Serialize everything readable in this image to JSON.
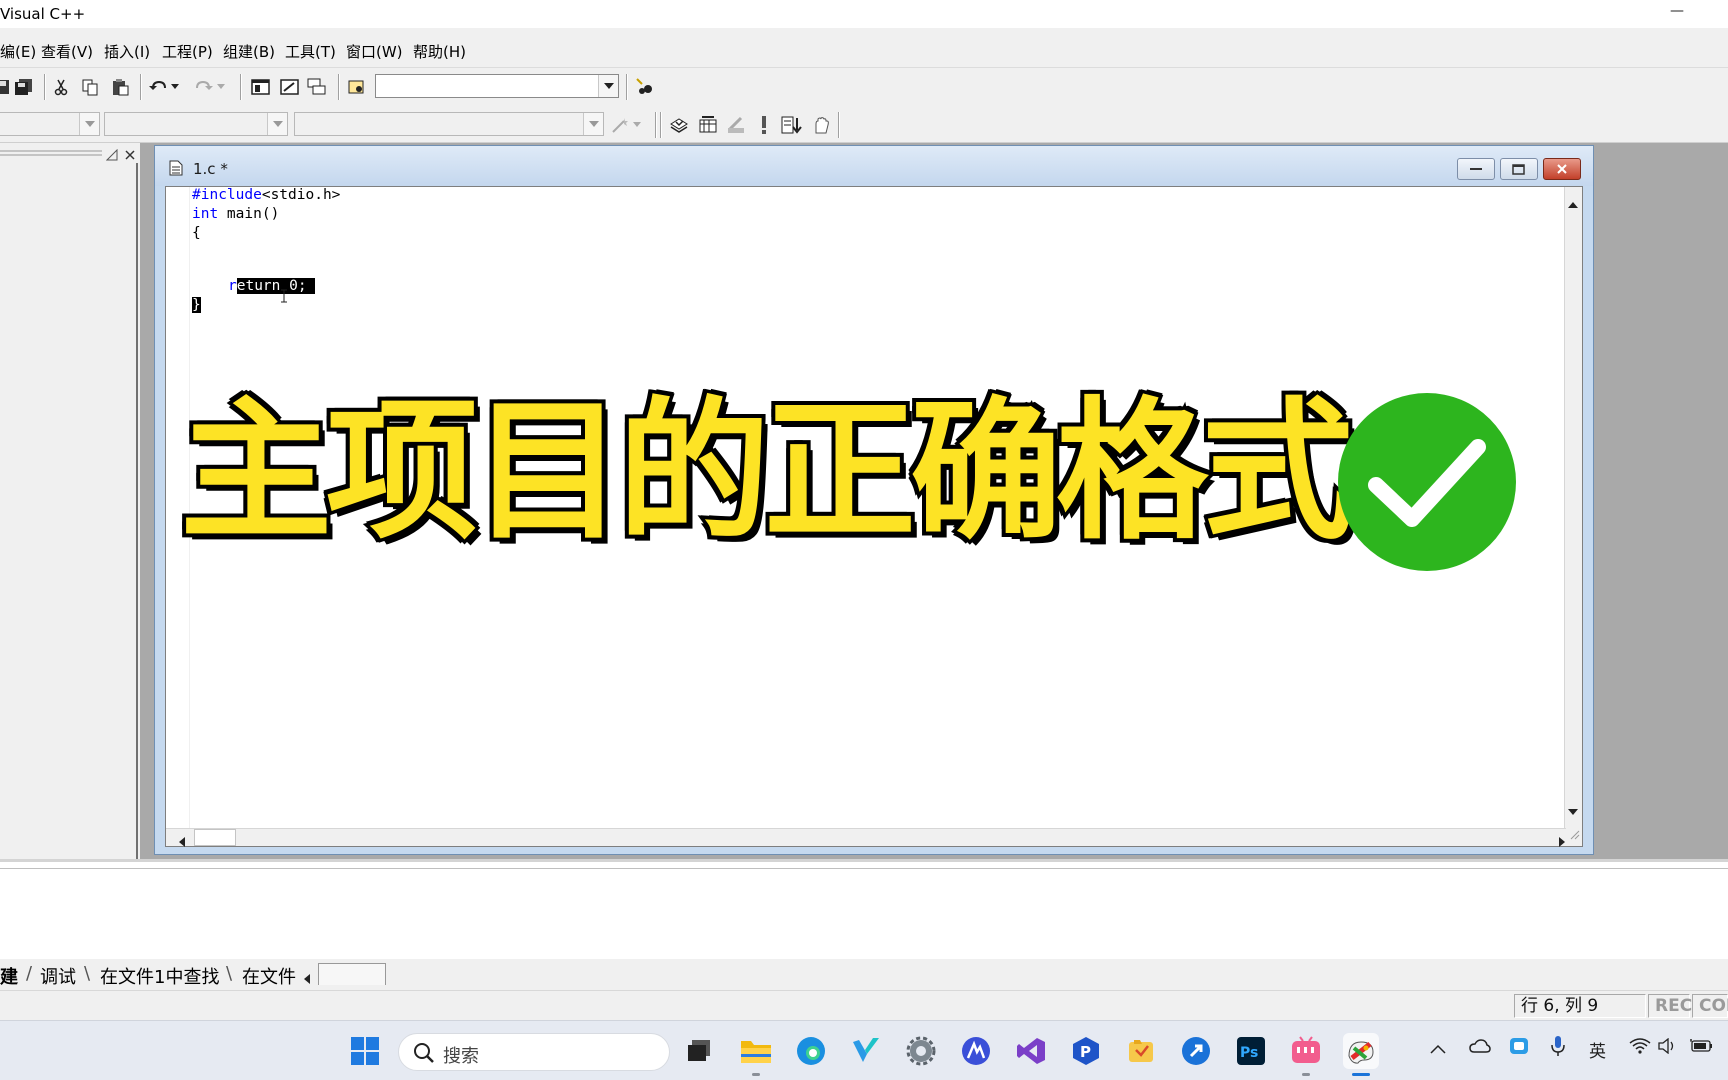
{
  "app": {
    "title": "Visual C++",
    "minimize_glyph": "—"
  },
  "menu": [
    "编(E)",
    "查看(V)",
    "插入(I)",
    "工程(P)",
    "组建(B)",
    "工具(T)",
    "窗口(W)",
    "帮助(H)"
  ],
  "document": {
    "title": "1.c *"
  },
  "code": {
    "line1_kw": "#include",
    "line1_rest": "<stdio.h>",
    "line2_kw": "int",
    "line2_rest": " main()",
    "line3": "{",
    "line5_prefix": "r",
    "line5_selected": "eturn 0; ",
    "line6": "}"
  },
  "overlay": {
    "headline": "主项目的正确格式"
  },
  "output_tabs": [
    "建",
    "调试",
    "在文件1中查找",
    "在文件"
  ],
  "status": {
    "position": "行 6, 列 9",
    "rec": "REC",
    "col": "COL"
  },
  "taskbar": {
    "search_placeholder": "搜索",
    "input_method": "英"
  },
  "colors": {
    "headline_fill": "#fde325",
    "headline_stroke": "#000000",
    "check_green": "#2db51e",
    "keyword_blue": "#0000ff"
  },
  "icons": {
    "taskbar": [
      "windows-start-icon",
      "search-icon",
      "task-view-icon",
      "file-explorer-icon",
      "edge-icon",
      "app-v-icon",
      "settings-icon",
      "app-a-icon",
      "visual-studio-icon",
      "app-p-icon",
      "app-folder-icon",
      "app-arrow-icon",
      "photoshop-icon",
      "bilibili-icon",
      "paint-app-icon"
    ],
    "tray": [
      "chevron-up-icon",
      "cloud-icon",
      "app-tray-icon",
      "microphone-icon",
      "wifi-icon",
      "volume-icon",
      "battery-icon"
    ]
  }
}
